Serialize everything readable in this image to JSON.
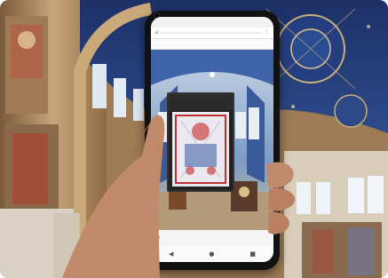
{
  "status": {
    "time": "",
    "battery": ""
  },
  "browser": {
    "url": "",
    "tab_title": ""
  },
  "panel": {
    "title": ""
  },
  "bottom": {
    "left_label": "",
    "right_label": ""
  },
  "colors": {
    "ceiling": "#27407a",
    "wall": "#b98e5a",
    "skin": "#c08a6a",
    "phone": "#111111"
  }
}
